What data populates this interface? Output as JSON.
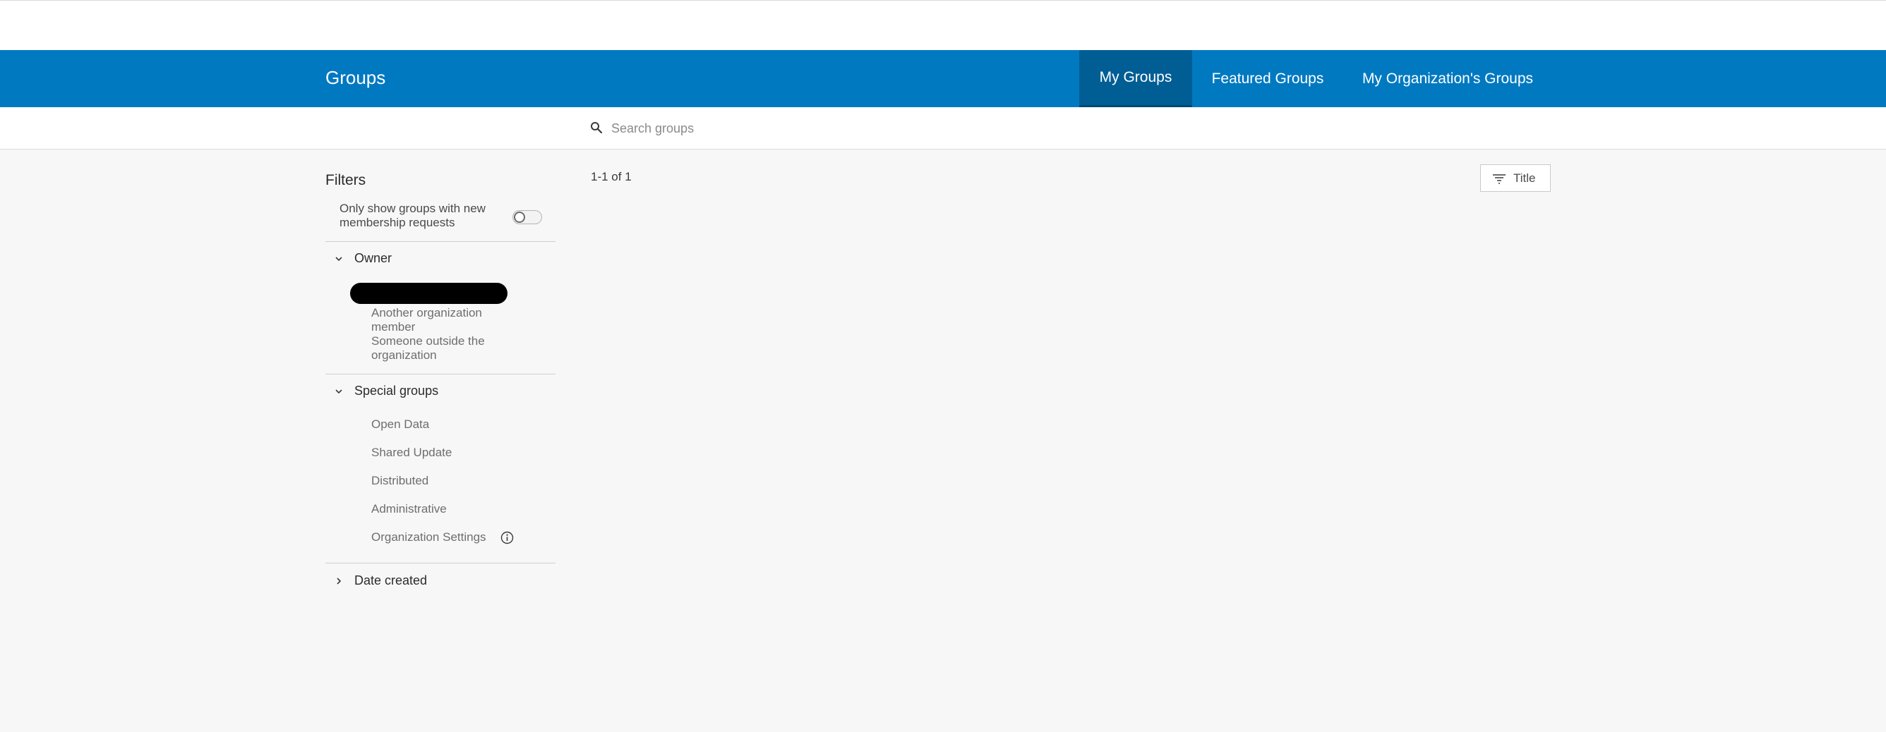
{
  "header": {
    "title": "Groups",
    "tabs": [
      {
        "label": "My Groups",
        "active": true
      },
      {
        "label": "Featured Groups",
        "active": false
      },
      {
        "label": "My Organization's Groups",
        "active": false
      }
    ]
  },
  "search": {
    "placeholder": "Search groups",
    "value": ""
  },
  "filters": {
    "title": "Filters",
    "membership_toggle": {
      "label": "Only show groups with new membership requests",
      "on": false
    },
    "owner": {
      "label": "Owner",
      "expanded": true,
      "options": [
        "Another organization member",
        "Someone outside the organization"
      ]
    },
    "special": {
      "label": "Special groups",
      "expanded": true,
      "options": [
        "Open Data",
        "Shared Update",
        "Distributed",
        "Administrative",
        "Organization Settings"
      ]
    },
    "date_created": {
      "label": "Date created",
      "expanded": false
    }
  },
  "results": {
    "count_text": "1-1 of 1"
  },
  "sort": {
    "label": "Title"
  },
  "colors": {
    "brand": "#0079c1",
    "active_tab": "#005e95",
    "background": "#f7f7f7"
  }
}
